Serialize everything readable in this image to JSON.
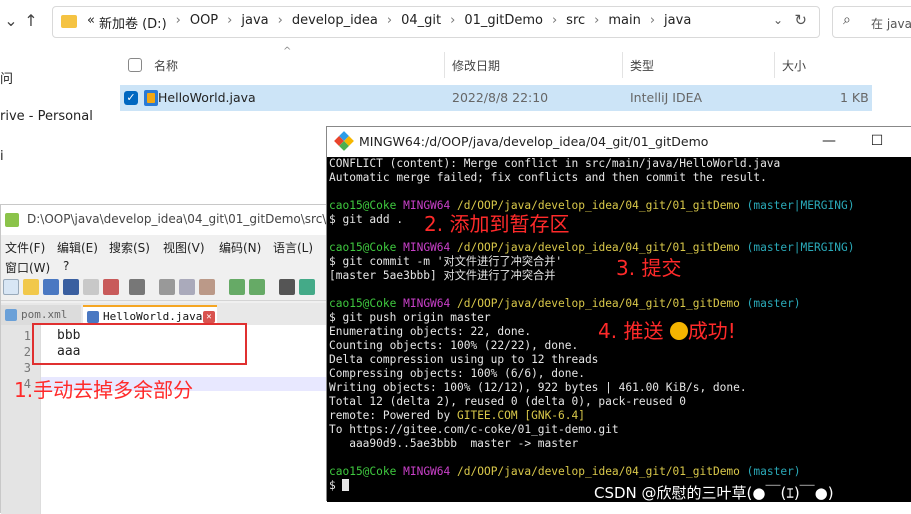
{
  "explorer": {
    "path": [
      "«",
      "新加卷 (D:)",
      "OOP",
      "java",
      "develop_idea",
      "04_git",
      "01_gitDemo",
      "src",
      "main",
      "java"
    ],
    "search_placeholder": "在 java",
    "sidebar": [
      "问",
      "rive - Personal",
      "i"
    ],
    "columns": {
      "name": "名称",
      "modified": "修改日期",
      "type": "类型",
      "size": "大小"
    },
    "file": {
      "name": "HelloWorld.java",
      "modified": "2022/8/8 22:10",
      "type": "IntelliJ IDEA",
      "size": "1 KB"
    }
  },
  "notepad": {
    "title": "D:\\OOP\\java\\develop_idea\\04_git\\01_gitDemo\\src\\m",
    "menu": [
      "文件(F)",
      "编辑(E)",
      "搜索(S)",
      "视图(V)",
      "编码(N)",
      "语言(L)",
      "窗口(W)",
      "?"
    ],
    "tabs": [
      "pom.xml",
      "HelloWorld.java"
    ],
    "lines": [
      {
        "n": "1",
        "text": "bbb"
      },
      {
        "n": "2",
        "text": "aaa"
      },
      {
        "n": "3",
        "text": ""
      },
      {
        "n": "4",
        "text": ""
      }
    ]
  },
  "terminal": {
    "title": "MINGW64:/d/OOP/java/develop_idea/04_git/01_gitDemo",
    "prompt_user": "cao15@Coke",
    "prompt_env": "MINGW64",
    "prompt_path": "/d/OOP/java/develop_idea/04_git/01_gitDemo",
    "conflict_1": "CONFLICT (content): Merge conflict in src/main/java/HelloWorld.java",
    "conflict_2": "Automatic merge failed; fix conflicts and then commit the result.",
    "branch_merging": "(master|MERGING)",
    "branch_master": "(master)",
    "cmd_add": "$ git add .",
    "cmd_commit": "$ git commit -m '对文件进行了冲突合并'",
    "commit_result": "[master 5ae3bbb] 对文件进行了冲突合并",
    "cmd_push": "$ git push origin master",
    "push_lines": [
      "Enumerating objects: 22, done.",
      "Counting objects: 100% (22/22), done.",
      "Delta compression using up to 12 threads",
      "Compressing objects: 100% (6/6), done.",
      "Writing objects: 100% (12/12), 922 bytes | 461.00 KiB/s, done.",
      "Total 12 (delta 2), reused 0 (delta 0), pack-reused 0"
    ],
    "remote_prefix": "remote: Powered by ",
    "remote_gitee": "GITEE.COM",
    "remote_gnk": "[GNK-6.4]",
    "to_line": "To https://gitee.com/c-coke/01_git-demo.git",
    "ref_line": "   aaa90d9..5ae3bbb  master -> master",
    "final_prompt": "$ "
  },
  "annotations": {
    "step1": "1.手动去掉多余部分",
    "step2": "2. 添加到暂存区",
    "step3": "3. 提交",
    "step4a": "4. 推送",
    "step4b": "成功!"
  },
  "watermark": "CSDN @欣慰的三叶草(●￣(ｴ)￣●)"
}
